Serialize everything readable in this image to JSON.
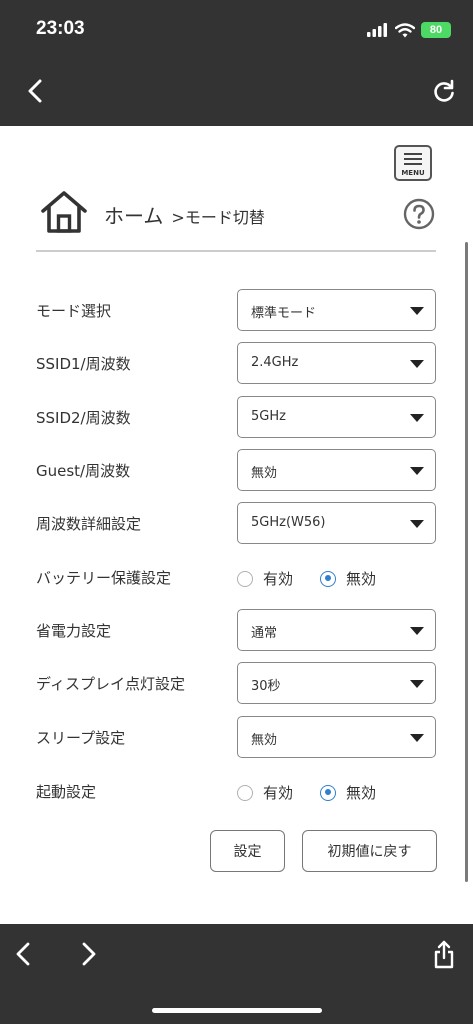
{
  "status_bar": {
    "time": "23:03",
    "battery": "80",
    "icons": [
      "signal-icon",
      "wifi-icon",
      "battery-charging-icon"
    ]
  },
  "browser": {
    "back_icon": "chevron-left-icon",
    "reload_icon": "reload-icon",
    "toolbar_icons": [
      "chevron-left-icon",
      "chevron-right-icon",
      "share-icon"
    ]
  },
  "header": {
    "menu_label": "MENU",
    "home_icon": "home-icon",
    "breadcrumb_home": "ホーム",
    "breadcrumb_separator": ">",
    "breadcrumb_current": "モード切替",
    "help_icon": "help-icon"
  },
  "form": {
    "rows": [
      {
        "label": "モード選択",
        "type": "select",
        "value": "標準モード"
      },
      {
        "label": "SSID1/周波数",
        "type": "select",
        "value": "2.4GHz"
      },
      {
        "label": "SSID2/周波数",
        "type": "select",
        "value": "5GHz"
      },
      {
        "label": "Guest/周波数",
        "type": "select",
        "value": "無効"
      },
      {
        "label": "周波数詳細設定",
        "type": "select",
        "value": "5GHz(W56)"
      },
      {
        "label": "バッテリー保護設定",
        "type": "radio",
        "options": [
          "有効",
          "無効"
        ],
        "selected": "無効"
      },
      {
        "label": "省電力設定",
        "type": "select",
        "value": "通常"
      },
      {
        "label": "ディスプレイ点灯設定",
        "type": "select",
        "value": "30秒"
      },
      {
        "label": "スリープ設定",
        "type": "select",
        "value": "無効"
      },
      {
        "label": "起動設定",
        "type": "radio",
        "options": [
          "有効",
          "無効"
        ],
        "selected": "無効"
      }
    ],
    "buttons": {
      "set_label": "設定",
      "reset_label": "初期値に戻す"
    }
  },
  "colors": {
    "bar_background": "#333333",
    "battery_green": "#4cd964",
    "radio_selected": "#2f7fd1",
    "border": "#888888"
  }
}
